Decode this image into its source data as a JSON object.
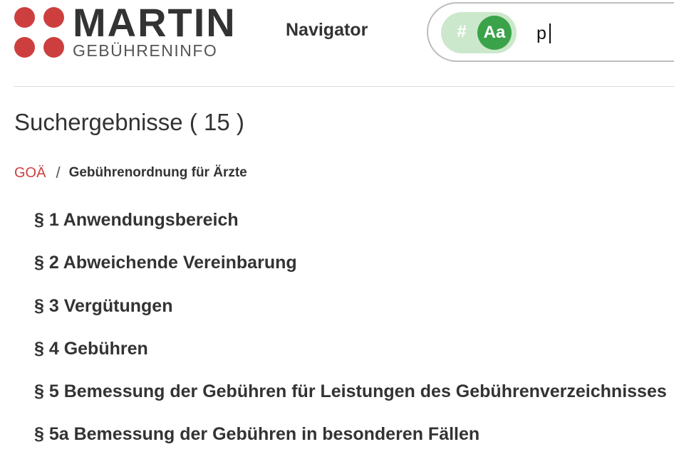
{
  "logo": {
    "brand": "MARTIN",
    "subtitle": "GEBÜHRENINFO",
    "dot_color": "#cd3f3f"
  },
  "nav": {
    "label": "Navigator"
  },
  "search": {
    "mode_hash_label": "#",
    "mode_text_label": "Aa",
    "active_mode": "text",
    "value": "p",
    "toggle_bg_color": "#cce8cc",
    "active_color": "#3aa34a"
  },
  "results": {
    "title": "Suchergebnisse ( 15 )",
    "breadcrumb": {
      "root": "GOÄ",
      "separator": "/",
      "current": "Gebührenordnung für Ärzte"
    },
    "items": [
      "§ 1 Anwendungsbereich",
      "§ 2 Abweichende Vereinbarung",
      "§ 3 Vergütungen",
      "§ 4 Gebühren",
      "§ 5 Bemessung der Gebühren für Leistungen des Gebührenverzeichnisses",
      "§ 5a Bemessung der Gebühren in besonderen Fällen"
    ]
  },
  "colors": {
    "accent_red": "#cd3f3f",
    "text": "#333333"
  }
}
